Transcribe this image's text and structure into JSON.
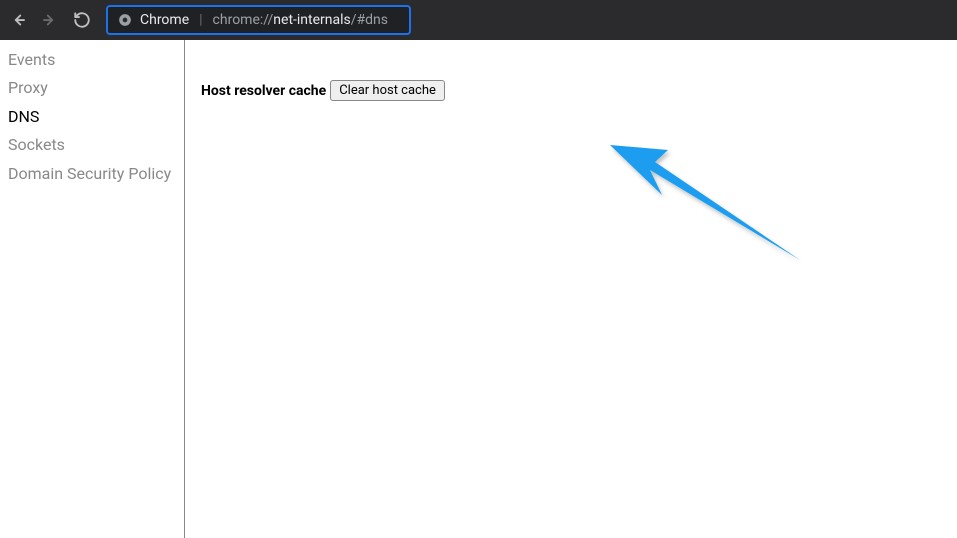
{
  "toolbar": {
    "chrome_label": "Chrome",
    "url_prefix": "chrome://",
    "url_main": "net-internals",
    "url_suffix": "/#dns"
  },
  "sidebar": {
    "items": [
      {
        "label": "Events",
        "active": false
      },
      {
        "label": "Proxy",
        "active": false
      },
      {
        "label": "DNS",
        "active": true
      },
      {
        "label": "Sockets",
        "active": false
      },
      {
        "label": "Domain Security Policy",
        "active": false
      }
    ]
  },
  "main": {
    "section_label": "Host resolver cache",
    "clear_button_label": "Clear host cache"
  }
}
